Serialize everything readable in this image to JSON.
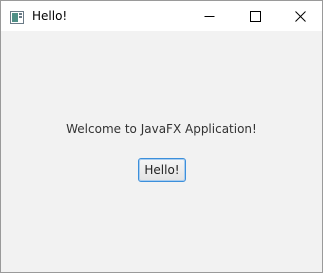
{
  "window": {
    "title": "Hello!",
    "icon": "java-app-icon"
  },
  "controls": {
    "minimize_icon": "minimize-icon",
    "maximize_icon": "maximize-icon",
    "close_icon": "close-icon"
  },
  "main": {
    "welcome_text": "Welcome to JavaFX Application!",
    "hello_button_label": "Hello!"
  },
  "colors": {
    "content_background": "#f2f2f2",
    "button_focus_border": "#3c8fdb",
    "text": "#333333"
  }
}
